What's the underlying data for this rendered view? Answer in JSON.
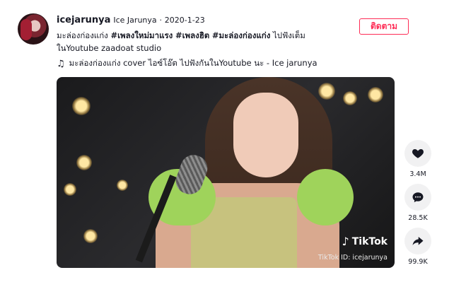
{
  "post": {
    "username": "icejarunya",
    "nickname": "Ice Jarunya",
    "separator": "·",
    "date": "2020-1-23",
    "caption_prefix": "มะล่องก่องแก่ง ",
    "tag1": "#เพลงใหม่มาแรง",
    "tag2": "#เพลงฮิต",
    "tag3": "#มะล่องก่องแก่ง",
    "caption_suffix": " ไปฟังเต็มในYoutube zaadoat studio",
    "music": "มะล่องก่องแก่ง cover ไอซ์โอ๊ต ไปฟังกันในYoutube นะ - Ice jarunya"
  },
  "follow_label": "ติดตาม",
  "video": {
    "watermark_logo": "TikTok",
    "watermark_id": "TikTok ID: icejarunya"
  },
  "actions": {
    "likes": "3.4M",
    "comments": "28.5K",
    "shares": "99.9K"
  },
  "icons": {
    "like": "heart-icon",
    "comment": "comment-icon",
    "share": "share-icon",
    "music": "music-note-icon"
  },
  "colors": {
    "accent": "#fe2c55",
    "text": "#161823",
    "action_bg": "#f1f1f2"
  }
}
